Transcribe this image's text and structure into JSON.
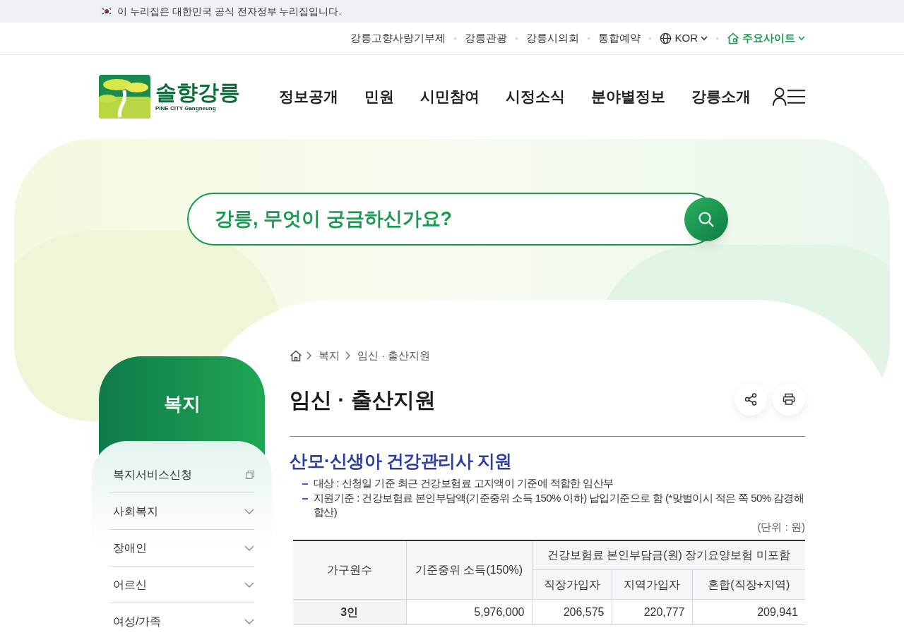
{
  "gov_banner": {
    "text": "이 누리집은 대한민국 공식 전자정부 누리집입니다."
  },
  "utility_links": [
    {
      "label": "강릉고향사랑기부제"
    },
    {
      "label": "강릉관광"
    },
    {
      "label": "강릉시의회"
    },
    {
      "label": "통합예약"
    }
  ],
  "language": {
    "label": "KOR"
  },
  "main_sites": {
    "label": "주요사이트"
  },
  "logo": {
    "title": "솔향강릉",
    "subtitle": "PINE CITY Gangneung"
  },
  "nav": [
    "정보공개",
    "민원",
    "시민참여",
    "시정소식",
    "분야별정보",
    "강릉소개"
  ],
  "search": {
    "placeholder": "강릉, 무엇이 궁금하신가요?"
  },
  "sidebar": {
    "title": "복지",
    "items": [
      {
        "label": "복지서비스신청",
        "kind": "external"
      },
      {
        "label": "사회복지",
        "kind": "expandable"
      },
      {
        "label": "장애인",
        "kind": "expandable"
      },
      {
        "label": "어르신",
        "kind": "expandable"
      },
      {
        "label": "여성/가족",
        "kind": "expandable"
      }
    ]
  },
  "breadcrumb": [
    "복지",
    "임신 · 출산지원"
  ],
  "page_title": "임신 · 출산지원",
  "section": {
    "heading": "산모·신생아 건강관리사 지원",
    "bullets": [
      "대상 : 신청일 기준 최근 건강보험료 고지액이 기준에 적합한 임산부",
      "지원기준 : 건강보험료 본인부담액(기준중위 소득 150% 이하) 납입기준으로 함 (*맞벌이시 적은 쪽 50% 감경해 합산)"
    ],
    "unit": "(단위 : 원)"
  },
  "table": {
    "columns": [
      "가구원수",
      "기준중위 소득(150%)"
    ],
    "group_header": "건강보험료 본인부담금(원) 장기요양보험 미포함",
    "sub_columns": [
      "직장가입자",
      "지역가입자",
      "혼합(직장+지역)"
    ],
    "rows": [
      [
        "3인",
        "5,976,000",
        "206,575",
        "220,777",
        "209,941"
      ]
    ]
  }
}
